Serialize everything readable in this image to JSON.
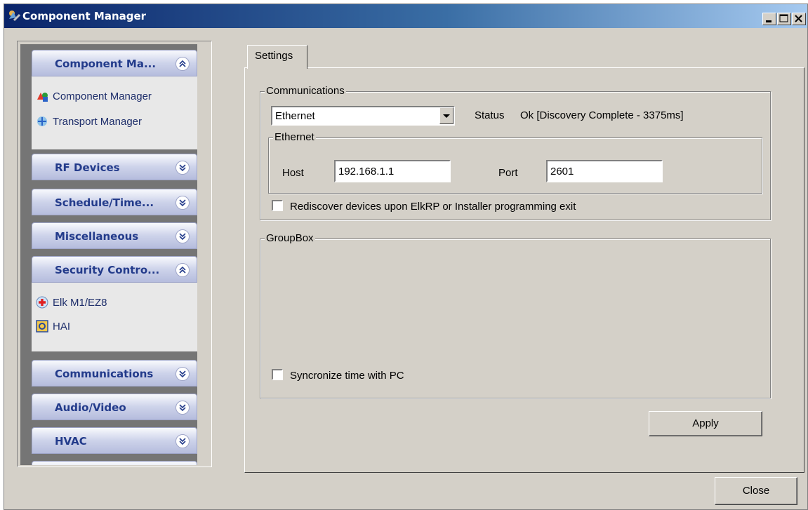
{
  "window": {
    "title": "Component Manager",
    "icon": "component-manager-icon",
    "controls": [
      "minimize-icon",
      "maximize-icon",
      "close-icon"
    ]
  },
  "sidebar": {
    "groups": [
      {
        "label": "Component Ma...",
        "expanded": true,
        "chevron": "chevron-up-icon",
        "items": [
          {
            "label": "Component Manager",
            "icon": "component-manager-icon"
          },
          {
            "label": "Transport Manager",
            "icon": "transport-manager-icon"
          }
        ]
      },
      {
        "label": "RF Devices",
        "expanded": false,
        "chevron": "chevron-down-icon"
      },
      {
        "label": "Schedule/Time...",
        "expanded": false,
        "chevron": "chevron-down-icon"
      },
      {
        "label": "Miscellaneous",
        "expanded": false,
        "chevron": "chevron-down-icon"
      },
      {
        "label": "Security Contro...",
        "expanded": true,
        "chevron": "chevron-up-icon",
        "items": [
          {
            "label": "Elk M1/EZ8",
            "icon": "medical-cross-icon"
          },
          {
            "label": "HAI",
            "icon": "hai-icon"
          }
        ]
      },
      {
        "label": "Communications",
        "expanded": false,
        "chevron": "chevron-down-icon"
      },
      {
        "label": "Audio/Video",
        "expanded": false,
        "chevron": "chevron-down-icon"
      },
      {
        "label": "HVAC",
        "expanded": false,
        "chevron": "chevron-down-icon"
      }
    ]
  },
  "tabs": [
    {
      "label": "Settings",
      "active": true
    }
  ],
  "communications": {
    "group_label": "Communications",
    "connection_type": "Ethernet",
    "status_label": "Status",
    "status_value": "Ok [Discovery Complete - 3375ms]",
    "ethernet": {
      "group_label": "Ethernet",
      "host_label": "Host",
      "host_value": "192.168.1.1",
      "port_label": "Port",
      "port_value": "2601"
    },
    "rediscover_label": "Rediscover devices upon ElkRP or Installer programming exit",
    "rediscover_checked": false
  },
  "groupbox": {
    "label": "GroupBox",
    "sync_label": "Syncronize time with PC",
    "sync_checked": false
  },
  "buttons": {
    "apply": "Apply",
    "close": "Close"
  }
}
